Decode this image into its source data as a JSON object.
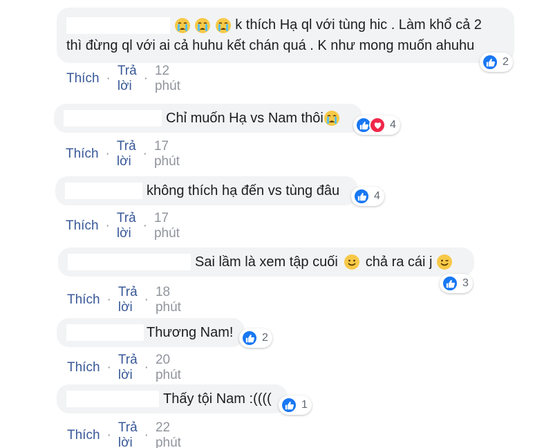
{
  "comments": [
    {
      "text_line1": "k thích Hạ ql với tùng hic . Làm khổ cả 2",
      "text_line2": "thì đừng ql với ai cả huhu kết chán quá . K như mong muốn ahuhu",
      "emoji": "crying-face-icon",
      "reaction_count": "2",
      "like_label": "Thích",
      "reply_label": "Trả lời",
      "time": "12 phút"
    },
    {
      "text": "Chỉ muốn Hạ vs Nam thôi",
      "emoji": "crying-face-icon",
      "reaction_count": "4",
      "like_label": "Thích",
      "reply_label": "Trả lời",
      "time": "17 phút"
    },
    {
      "text": "không thích hạ đến vs tùng đâu",
      "reaction_count": "4",
      "like_label": "Thích",
      "reply_label": "Trả lời",
      "time": "17 phút"
    },
    {
      "text_a": "Sai lầm là xem tập cuối",
      "text_b": "chả ra cái j",
      "reaction_count": "3",
      "like_label": "Thích",
      "reply_label": "Trả lời",
      "time": "18 phút"
    },
    {
      "text": "Thương Nam!",
      "reaction_count": "2",
      "like_label": "Thích",
      "reply_label": "Trả lời",
      "time": "20 phút"
    },
    {
      "text": "Thấy tội Nam :((((",
      "reaction_count": "1",
      "like_label": "Thích",
      "reply_label": "Trả lời",
      "time": "22 phút"
    }
  ],
  "colors": {
    "link": "#385898",
    "muted": "#90949c",
    "bubble": "#f2f3f5",
    "like": "#1877f2",
    "love": "#f0284a"
  }
}
